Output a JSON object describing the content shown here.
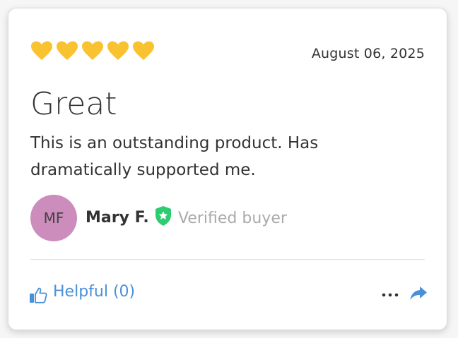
{
  "review": {
    "rating": 5,
    "rating_max": 5,
    "date": "August 06, 2025",
    "title": "Great",
    "body": "This is an outstanding product. Has dramatically supported me."
  },
  "reviewer": {
    "initials": "MF",
    "name": "Mary F.",
    "badge_label": "Verified buyer"
  },
  "actions": {
    "helpful_label": "Helpful (0)",
    "more_icon": "ellipsis-icon",
    "share_icon": "share-icon",
    "helpful_icon": "thumbs-up-icon"
  },
  "colors": {
    "heart": "#f9c230",
    "avatar_bg": "#cc8cbc",
    "verified_badge": "#2ecc71",
    "link": "#4a90d9"
  }
}
